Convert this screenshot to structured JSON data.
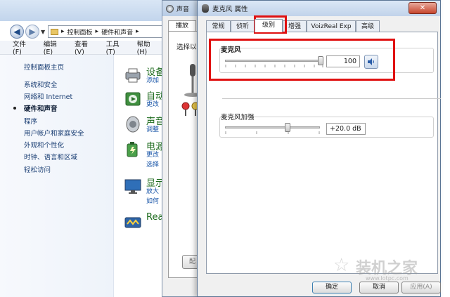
{
  "control_panel": {
    "address": {
      "segments": [
        "控制面板",
        "硬件和声音"
      ]
    },
    "menu": [
      "文件(F)",
      "编辑(E)",
      "查看(V)",
      "工具(T)",
      "帮助(H)"
    ],
    "sidebar": {
      "home": "控制面板主页",
      "items": [
        "系统和安全",
        "网络和 Internet",
        "硬件和声音",
        "程序",
        "用户帐户和家庭安全",
        "外观和个性化",
        "时钟、语言和区域",
        "轻松访问"
      ],
      "current_index": 2
    },
    "categories": [
      {
        "title": "设备",
        "sub": [
          "添加"
        ]
      },
      {
        "title": "自动",
        "sub": [
          "更改"
        ]
      },
      {
        "title": "声音",
        "sub": [
          "调整"
        ]
      },
      {
        "title": "电源",
        "sub": [
          "更改",
          "选择"
        ]
      },
      {
        "title": "显示",
        "sub": [
          "放大",
          "如何"
        ]
      },
      {
        "title": "Real",
        "sub": []
      }
    ]
  },
  "sound_dialog": {
    "title": "声音",
    "tab": "播放",
    "hint": "选择以下",
    "button": "配"
  },
  "mic_dialog": {
    "title": "麦克风 属性",
    "close": "✕",
    "tabs": [
      "常规",
      "侦听",
      "级别",
      "增强",
      "VoizReal Exp",
      "高级"
    ],
    "active_tab_index": 2,
    "levels": {
      "mic_label": "麦克风",
      "mic_value": "100",
      "mic_level_fraction": 1.0,
      "boost_label": "麦克风加强",
      "boost_value": "+20.0 dB",
      "boost_level_fraction": 0.67
    },
    "buttons": {
      "ok": "确定",
      "cancel": "取消",
      "apply": "应用(A)"
    }
  },
  "watermark": {
    "text": "装机之家",
    "url": "www.lotpc.com"
  },
  "highlight_color": "#e01010"
}
